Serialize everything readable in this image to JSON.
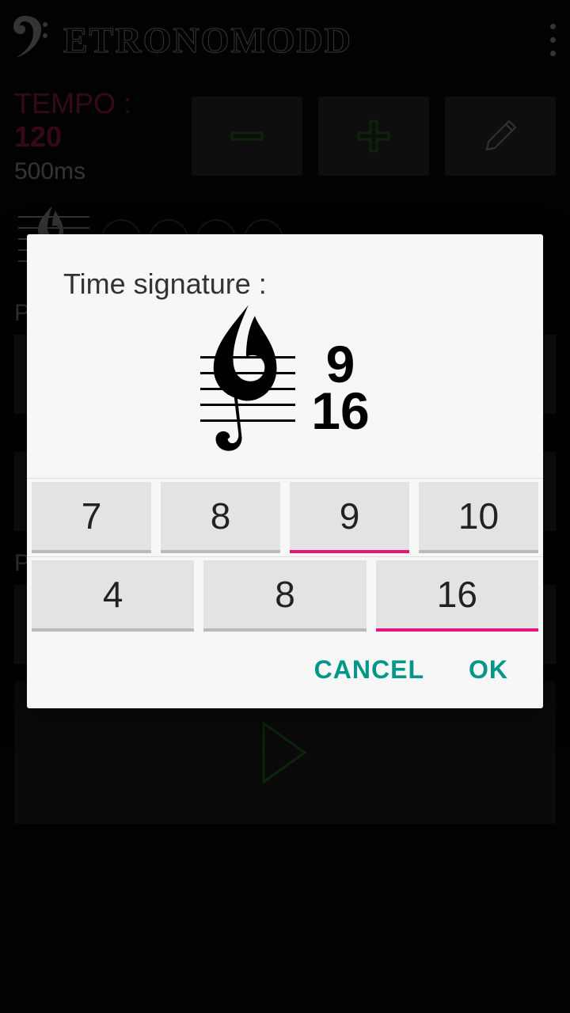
{
  "header": {
    "app_title": "ETRONOMODD"
  },
  "tempo": {
    "label": "TEMPO : ",
    "value": "120",
    "ms": "500ms"
  },
  "bg": {
    "section_p": "P",
    "section_pl": "Pl"
  },
  "dialog": {
    "title": "Time signature :",
    "numerator": "9",
    "denominator": "16",
    "numerator_options": [
      "7",
      "8",
      "9",
      "10"
    ],
    "numerator_selected_index": 2,
    "denominator_options": [
      "4",
      "8",
      "16"
    ],
    "denominator_selected_index": 2,
    "cancel": "CANCEL",
    "ok": "OK"
  }
}
